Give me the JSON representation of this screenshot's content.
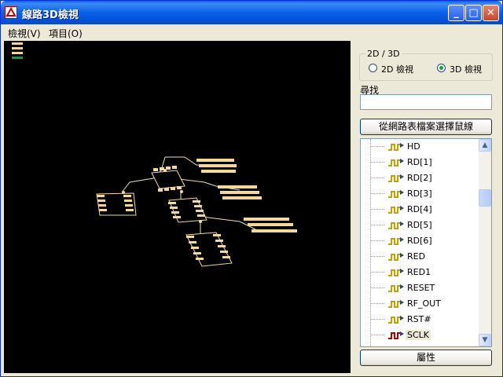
{
  "window": {
    "title": "線路3D檢視"
  },
  "titlebar_buttons": {
    "minimize": "_",
    "maximize": "□",
    "close": "✕"
  },
  "menu": [
    {
      "label": "檢視(V)"
    },
    {
      "label": "項目(O)"
    }
  ],
  "panel": {
    "mode_group_label": "2D / 3D",
    "mode_options": [
      {
        "label": "2D 檢視",
        "selected": false
      },
      {
        "label": "3D 檢視",
        "selected": true
      }
    ],
    "search_label": "尋找",
    "search_value": "",
    "select_button": "從網路表檔案選擇鼠線",
    "properties_button": "屬性",
    "net_list": [
      {
        "label": "HD",
        "icon": "net-icon"
      },
      {
        "label": "RD[1]",
        "icon": "net-icon"
      },
      {
        "label": "RD[2]",
        "icon": "net-icon"
      },
      {
        "label": "RD[3]",
        "icon": "net-icon"
      },
      {
        "label": "RD[4]",
        "icon": "net-icon"
      },
      {
        "label": "RD[5]",
        "icon": "net-icon"
      },
      {
        "label": "RD[6]",
        "icon": "net-icon"
      },
      {
        "label": "RED",
        "icon": "net-icon"
      },
      {
        "label": "RED1",
        "icon": "net-icon"
      },
      {
        "label": "RESET",
        "icon": "net-icon"
      },
      {
        "label": "RF_OUT",
        "icon": "net-icon"
      },
      {
        "label": "RST#",
        "icon": "net-icon"
      },
      {
        "label": "SCLK",
        "icon": "net-icon-selected",
        "selected": true
      }
    ]
  },
  "colors": {
    "pad": "#F5D79A",
    "trace": "#E8E0A0",
    "net_icon_yellow": "#C8A000",
    "net_icon_selected": "#B00000"
  }
}
